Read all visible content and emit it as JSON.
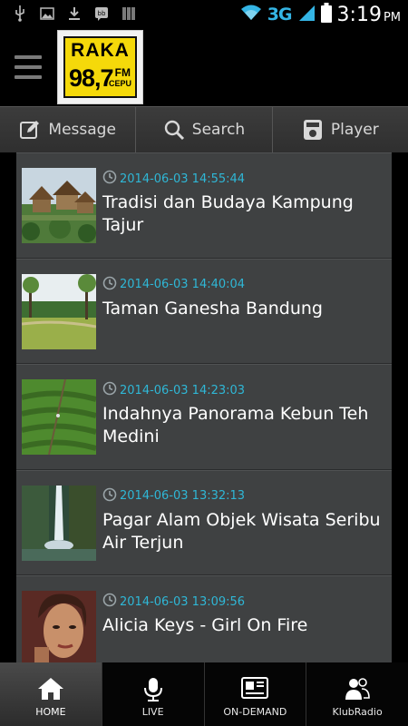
{
  "status_bar": {
    "network": "3G",
    "time": "3:19",
    "ampm": "PM",
    "icons": [
      "usb-icon",
      "image-icon",
      "download-icon",
      "bbm-icon",
      "barcode-icon",
      "wifi-icon",
      "signal-icon",
      "battery-icon"
    ]
  },
  "header": {
    "logo": {
      "name": "RAKA",
      "frequency": "98,7",
      "band": "FM",
      "city": "CEPU"
    }
  },
  "toolbar": {
    "message_label": "Message",
    "search_label": "Search",
    "player_label": "Player"
  },
  "news": [
    {
      "timestamp": "2014-06-03 14:55:44",
      "title": "Tradisi dan Budaya Kampung Tajur",
      "thumb": "village-photo"
    },
    {
      "timestamp": "2014-06-03 14:40:04",
      "title": "Taman Ganesha Bandung",
      "thumb": "park-photo"
    },
    {
      "timestamp": "2014-06-03 14:23:03",
      "title": "Indahnya Panorama Kebun Teh Medini",
      "thumb": "tea-plantation-photo"
    },
    {
      "timestamp": "2014-06-03 13:32:13",
      "title": "Pagar Alam Objek Wisata Seribu Air Terjun",
      "thumb": "waterfall-photo"
    },
    {
      "timestamp": "2014-06-03 13:09:56",
      "title": "Alicia Keys - Girl On Fire",
      "thumb": "portrait-photo"
    }
  ],
  "bottom_nav": [
    {
      "label": "HOME",
      "icon": "home-icon",
      "active": true
    },
    {
      "label": "LIVE",
      "icon": "microphone-icon",
      "active": false
    },
    {
      "label": "ON-DEMAND",
      "icon": "media-player-icon",
      "active": false
    },
    {
      "label": "KlubRadio",
      "icon": "people-icon",
      "active": false
    }
  ],
  "colors": {
    "accent_timestamp": "#2fb7d6",
    "network_blue": "#34b5e5",
    "logo_yellow": "#f5d90a",
    "list_bg": "#3f4142"
  }
}
